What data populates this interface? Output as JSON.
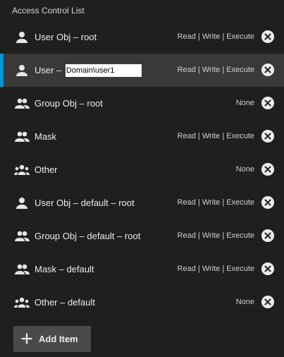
{
  "title": "Access Control List",
  "entries": [
    {
      "label": "User Obj – root",
      "permissions": "Read | Write | Execute",
      "icon": "person-icon"
    },
    {
      "label": "User – ",
      "input_value": "Domain\\user1",
      "permissions": "Read | Write | Execute",
      "icon": "person-icon"
    },
    {
      "label": "Group Obj – root",
      "permissions": "None",
      "icon": "group-icon"
    },
    {
      "label": "Mask",
      "permissions": "Read | Write | Execute",
      "icon": "group-icon"
    },
    {
      "label": "Other",
      "permissions": "None",
      "icon": "groups-icon"
    },
    {
      "label": "User Obj – default – root",
      "permissions": "Read | Write | Execute",
      "icon": "person-icon"
    },
    {
      "label": "Group Obj – default – root",
      "permissions": "Read | Write | Execute",
      "icon": "group-icon"
    },
    {
      "label": "Mask – default",
      "permissions": "Read | Write | Execute",
      "icon": "group-icon"
    },
    {
      "label": "Other – default",
      "permissions": "None",
      "icon": "groups-icon"
    }
  ],
  "add_button": {
    "label": "Add Item",
    "icon": "plus-icon"
  },
  "colors": {
    "background": "#1f1f1f",
    "selected_row": "#393939",
    "accent": "#0095d5"
  }
}
